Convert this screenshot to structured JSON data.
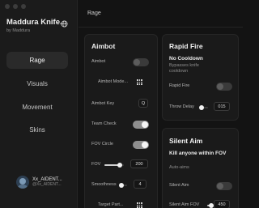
{
  "app": {
    "title": "Maddura Knife...",
    "subtitle": "by Maddura",
    "icon": "globe-icon"
  },
  "sidebar": {
    "items": [
      {
        "label": "Rage",
        "active": true
      },
      {
        "label": "Visuals",
        "active": false
      },
      {
        "label": "Movement",
        "active": false
      },
      {
        "label": "Skins",
        "active": false
      }
    ]
  },
  "user": {
    "name": "Xx_AIDENT...",
    "tag": "@Xx_AIDENT..."
  },
  "header": {
    "title": "Rage"
  },
  "aimbot": {
    "title": "Aimbot",
    "aimbot_label": "Aimbot",
    "aimbot_on": false,
    "mode_label": "Aimbot Mode...",
    "key_label": "Aimbot Key",
    "key_value": "Q",
    "team_check_label": "Team Check",
    "team_check_on": true,
    "fov_circle_label": "FOV Circle",
    "fov_circle_on": true,
    "fov_label": "FOV",
    "fov_value": "200",
    "fov_fraction": 0.8,
    "smoothness_label": "Smoothness",
    "smoothness_value": "4",
    "smoothness_fraction": 0.15,
    "target_part_label": "Target Part..."
  },
  "rapid_fire": {
    "title": "Rapid Fire",
    "desc_title": "No Cooldown",
    "desc": "Bypasses knife cooldown",
    "rapid_fire_label": "Rapid Fire",
    "rapid_fire_on": false,
    "throw_delay_label": "Throw Delay",
    "throw_delay_value": "015",
    "throw_delay_fraction": 0.05
  },
  "silent_aim": {
    "title": "Silent Aim",
    "desc_title": "Kill anyone within FOV",
    "desc": "Auto-aims",
    "silent_aim_label": "Silent Aim",
    "silent_aim_on": false,
    "fov_label": "Silent Aim FOV",
    "fov_value": "450",
    "fov_fraction": 0.9
  },
  "colors": {
    "background": "#131313",
    "panel": "#1a1a1a",
    "toggle_on": "#f5f5f5",
    "toggle_off": "#3a3a3a"
  }
}
